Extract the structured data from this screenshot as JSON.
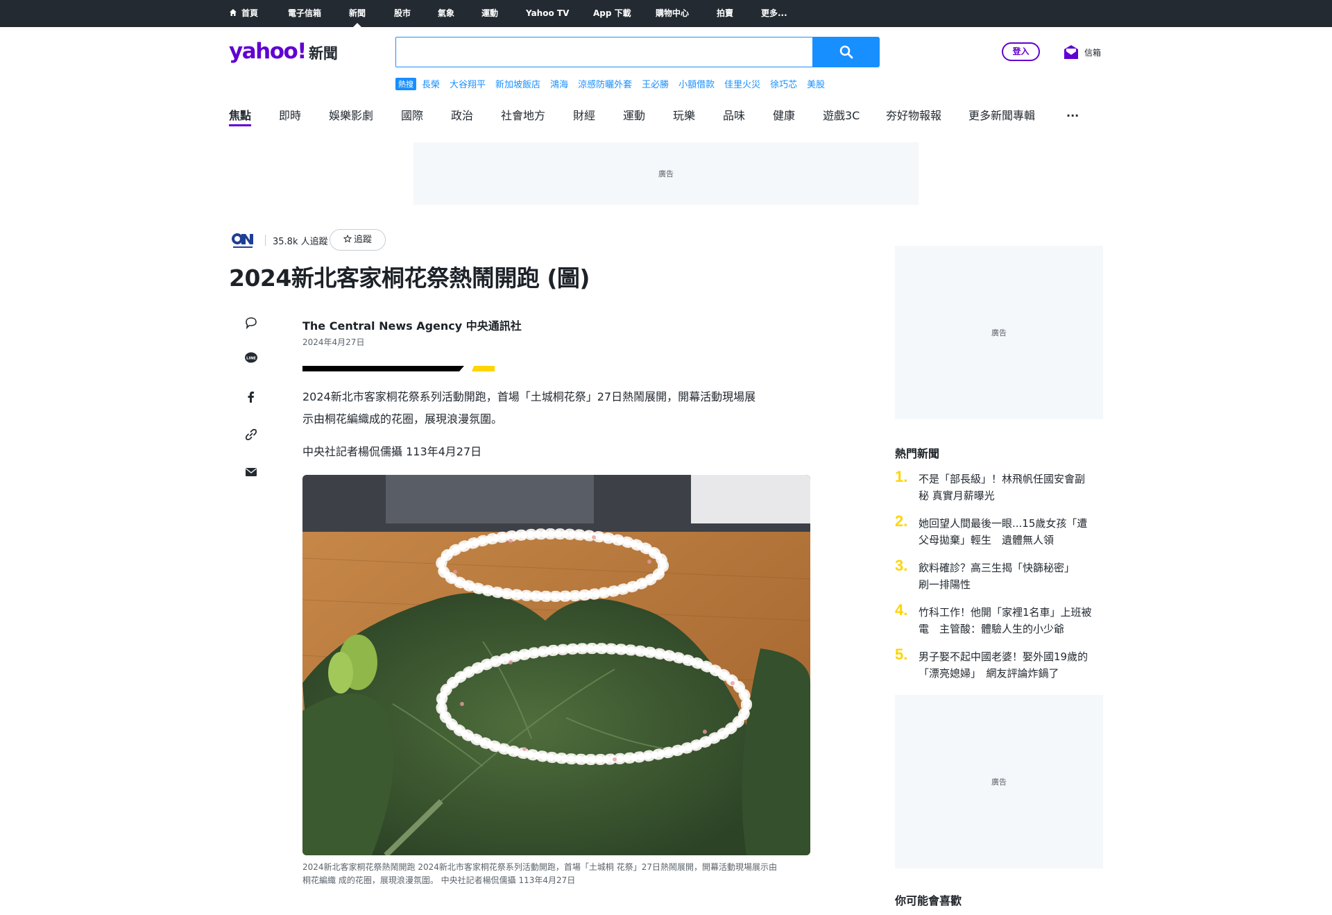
{
  "topnav": {
    "items": [
      "首頁",
      "電子信箱",
      "新聞",
      "股市",
      "氣象",
      "運動",
      "Yahoo TV",
      "App 下載",
      "購物中心",
      "拍賣",
      "更多..."
    ],
    "active_index": 2
  },
  "header": {
    "logo_text": "yahoo!",
    "logo_section": "新聞",
    "search": {
      "value": "",
      "placeholder": ""
    },
    "hot_label": "熱搜",
    "trending_links": [
      "長榮",
      "大谷翔平",
      "新加坡飯店",
      "鴻海",
      "涼感防曬外套",
      "王必勝",
      "小額借款",
      "佳里火災",
      "徐巧芯",
      "美股"
    ],
    "signin_label": "登入",
    "mail_label": "信箱"
  },
  "categories": {
    "items": [
      "焦點",
      "即時",
      "娛樂影劇",
      "國際",
      "政治",
      "社會地方",
      "財經",
      "運動",
      "玩樂",
      "品味",
      "健康",
      "遊戲3C",
      "夯好物報報",
      "更多新聞專輯",
      "..."
    ],
    "active_index": 0
  },
  "ads": {
    "label": "廣告"
  },
  "article": {
    "publisher_logo": "CNA",
    "followers": "35.8k 人追蹤",
    "follow_label": "追蹤",
    "title": "2024新北客家桐花祭熱鬧開跑 (圖)",
    "author": "The Central News Agency 中央通訊社",
    "date": "2024年4月27日",
    "paragraph_1_line_1": "2024新北市客家桐花祭系列活動開跑，首場「土城桐花祭」27日熱鬧展開，開幕活動現場展",
    "paragraph_1_line_2": "示由桐花編織成的花圈，展現浪漫氛圍。",
    "paragraph_2": "中央社記者楊侃儒攝 113年4月27日",
    "caption_line_1": "2024新北客家桐花祭熱鬧開跑 2024新北市客家桐花祭系列活動開跑，首場「土城桐 花祭」27日熱鬧展開，開幕活動現場展示由",
    "caption_line_2": "桐花編織 成的花圈，展現浪漫氛圍。 中央社記者楊侃儒攝 113年4月27日"
  },
  "sidebar": {
    "trending_title": "熱門新聞",
    "trending": [
      {
        "rank": "1.",
        "line1": "不是「部長級」！林飛帆任國安會副",
        "line2": "秘 真實月薪曝光"
      },
      {
        "rank": "2.",
        "line1": "她回望人間最後一眼...15歲女孩「遭",
        "line2": "父母拋棄」輕生　遺體無人領"
      },
      {
        "rank": "3.",
        "line1": "飲料確診？高三生揭「快篩秘密」",
        "line2": "刷一排陽性"
      },
      {
        "rank": "4.",
        "line1": "竹科工作！他開「家裡1名車」上班被",
        "line2": "電　主管酸：體驗人生的小少爺"
      },
      {
        "rank": "5.",
        "line1": "男子娶不起中國老婆！娶外國19歲的",
        "line2": "「漂亮媳婦」　網友評論炸鍋了"
      }
    ],
    "may_like_title": "你可能會喜歡"
  },
  "colors": {
    "topbar": "#232a31",
    "brand_purple": "#6001d2",
    "search_blue": "#188fff",
    "rank_yellow": "#ffd400",
    "ad_bg": "#f5f8fa"
  }
}
